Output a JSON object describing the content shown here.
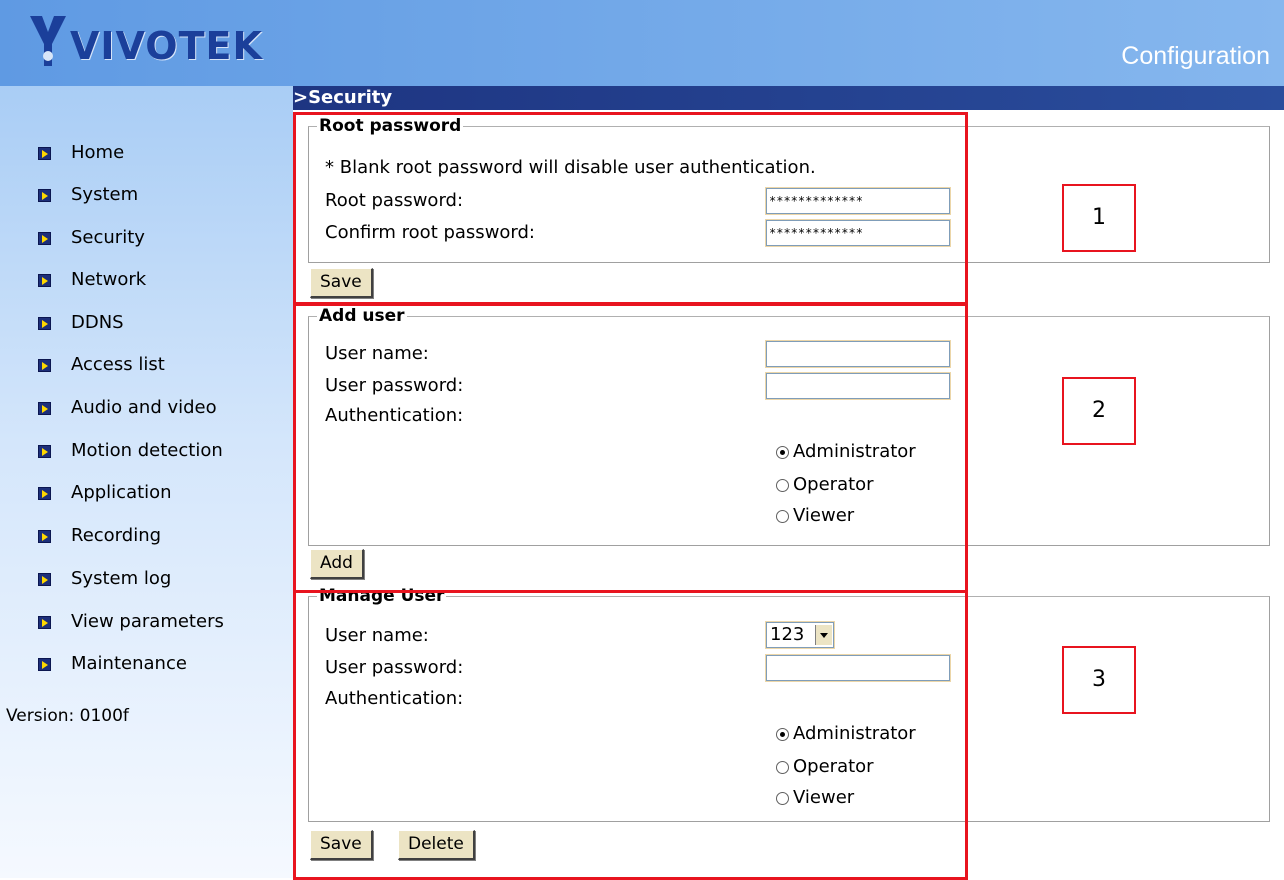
{
  "header": {
    "brand": "VIVOTEK",
    "logo_icon": "vivotek-logo-icon",
    "page_title": "Configuration"
  },
  "sidebar": {
    "items": [
      {
        "label": "Home"
      },
      {
        "label": "System"
      },
      {
        "label": "Security"
      },
      {
        "label": "Network"
      },
      {
        "label": "DDNS"
      },
      {
        "label": "Access list"
      },
      {
        "label": "Audio and video"
      },
      {
        "label": "Motion detection"
      },
      {
        "label": "Application"
      },
      {
        "label": "Recording"
      },
      {
        "label": "System log"
      },
      {
        "label": "View parameters"
      },
      {
        "label": "Maintenance"
      }
    ],
    "version": "Version: 0100f"
  },
  "section": {
    "title": ">Security"
  },
  "root_password": {
    "legend": "Root password",
    "note": "* Blank root password will disable user authentication.",
    "password_label": "Root password:",
    "password_value": "*************",
    "confirm_label": "Confirm root password:",
    "confirm_value": "*************",
    "save_label": "Save"
  },
  "add_user": {
    "legend": "Add user",
    "username_label": "User name:",
    "username_value": "",
    "password_label": "User password:",
    "password_value": "",
    "auth_label": "Authentication:",
    "roles": [
      "Administrator",
      "Operator",
      "Viewer"
    ],
    "selected_role": "Administrator",
    "add_label": "Add"
  },
  "manage_user": {
    "legend": "Manage User",
    "username_label": "User name:",
    "username_selected": "123",
    "password_label": "User password:",
    "password_value": "",
    "auth_label": "Authentication:",
    "roles": [
      "Administrator",
      "Operator",
      "Viewer"
    ],
    "selected_role": "Administrator",
    "save_label": "Save",
    "delete_label": "Delete"
  },
  "callouts": [
    "1",
    "2",
    "3"
  ],
  "colors": {
    "header_blue": "#5f9ae3",
    "section_bar": "#1e3582",
    "annotation_red": "#e8141f",
    "button_face": "#ece4c4"
  }
}
